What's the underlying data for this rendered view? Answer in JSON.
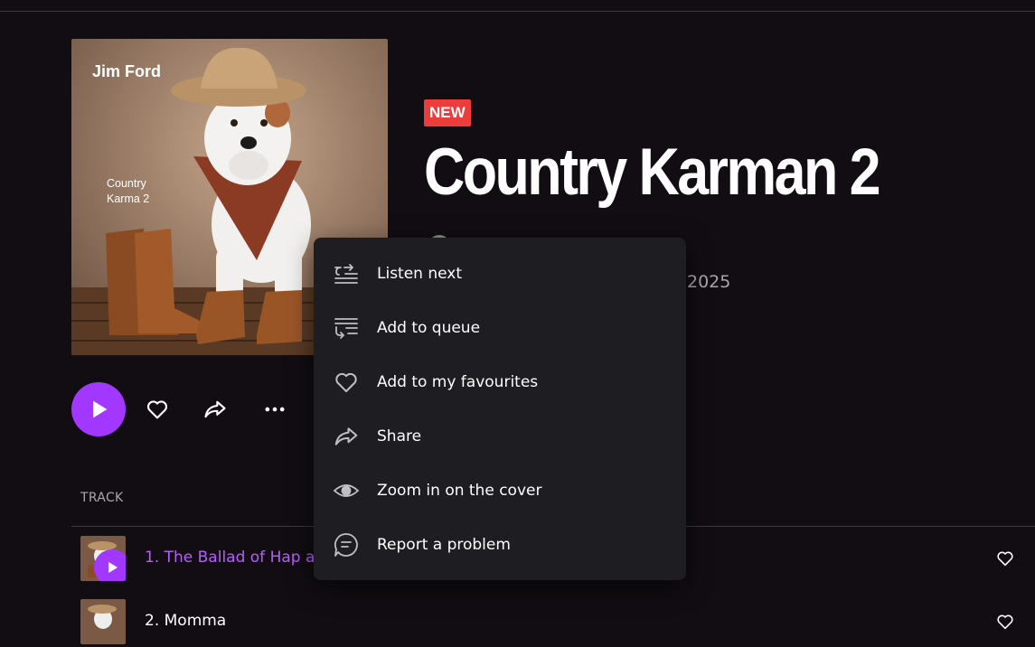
{
  "album": {
    "badge": "NEW",
    "title": "Country Karman 2",
    "year_partial": "2025",
    "cover": {
      "artist_text": "Jim Ford",
      "album_text": "Country\nKarma 2"
    }
  },
  "actions": {
    "play_icon": "play-icon",
    "favourite_icon": "heart-icon",
    "share_icon": "share-icon",
    "more_icon": "more-icon"
  },
  "tracklist": {
    "column_track": "TRACK",
    "tracks": [
      {
        "title": "1. The Ballad of Hap an",
        "active": true
      },
      {
        "title": "2. Momma",
        "active": false
      }
    ]
  },
  "context_menu": {
    "items": [
      {
        "label": "Listen next",
        "icon": "listen-next-icon"
      },
      {
        "label": "Add to queue",
        "icon": "add-to-queue-icon"
      },
      {
        "label": "Add to my favourites",
        "icon": "heart-icon"
      },
      {
        "label": "Share",
        "icon": "share-icon"
      },
      {
        "label": "Zoom in on the cover",
        "icon": "eye-icon"
      },
      {
        "label": "Report a problem",
        "icon": "report-icon"
      }
    ]
  },
  "colors": {
    "background": "#110d12",
    "accent": "#a238ff",
    "badge": "#ec3c3c",
    "menu_bg": "#1d1d22",
    "muted_text": "#a7a7ad"
  }
}
